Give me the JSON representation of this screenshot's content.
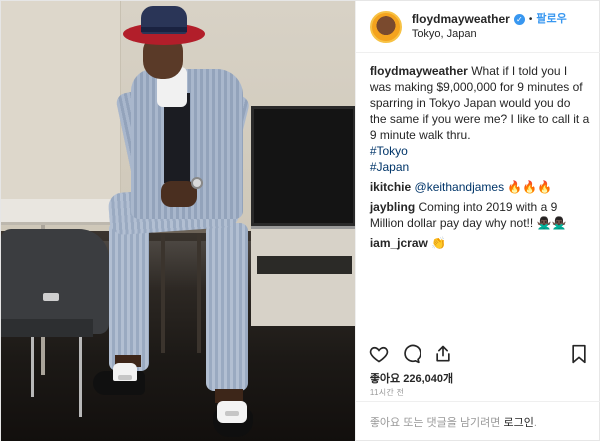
{
  "header": {
    "username": "floydmayweather",
    "verified_icon": "✓",
    "separator": "•",
    "follow_label": "팔로우",
    "location": "Tokyo, Japan"
  },
  "caption": {
    "username": "floydmayweather",
    "text": "What if I told you I was making $9,000,000 for 9 minutes of sparring in Tokyo Japan would you do the same if you were me? I like to call it a 9 minute walk thru.",
    "hashtags": [
      "#Tokyo",
      "#Japan"
    ]
  },
  "comments": [
    {
      "username": "ikitchie",
      "mention": "@keithandjames",
      "text": "🔥🔥🔥"
    },
    {
      "username": "jaybling",
      "text": "Coming into 2019 with a 9 Million dollar pay day why not!! 🙅🏿‍♂️🙅🏿‍♂️"
    },
    {
      "username": "iam_jcraw",
      "text": "👏"
    }
  ],
  "actions": {
    "icons": [
      "heart-icon",
      "comment-icon",
      "share-icon",
      "bookmark-icon"
    ]
  },
  "stats": {
    "likes_label": "좋아요 226,040개",
    "timestamp": "11시간 전"
  },
  "footer": {
    "prompt_text": "좋아요 또는 댓글을 남기려면",
    "login_label": "로그인",
    "end_punct": "."
  },
  "colors": {
    "accent": "#3897f0",
    "link": "#003569",
    "muted": "#999999"
  }
}
